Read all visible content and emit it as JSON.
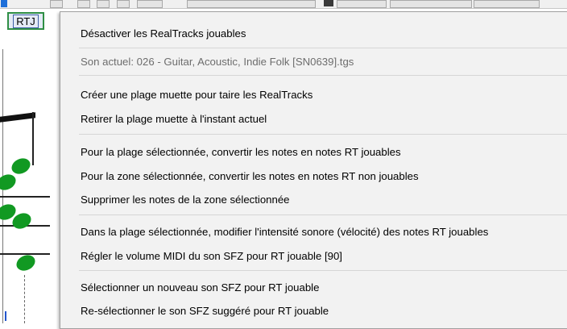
{
  "toolbar": {
    "rtj_label": "RTJ"
  },
  "menu": {
    "deactivate": "Désactiver les RealTracks jouables",
    "current_sound": "Son actuel: 026 - Guitar, Acoustic, Indie Folk [SN0639].tgs",
    "create_mute_range": "Créer une plage muette pour taire les RealTracks",
    "remove_mute_range": "Retirer la plage muette à l'instant actuel",
    "convert_playable": "Pour la plage sélectionnée, convertir les notes en notes RT jouables",
    "convert_non_playable": "Pour la zone sélectionnée, convertir les notes en notes RT non jouables",
    "delete_notes": "Supprimer les notes de la zone sélectionnée",
    "modify_velocity": "Dans la plage sélectionnée, modifier l'intensité sonore (vélocité) des notes RT jouables",
    "set_midi_volume": "Régler le volume MIDI du son SFZ pour RT jouable [90]",
    "select_new_sfz": "Sélectionner un nouveau son SFZ pour RT jouable",
    "reselect_suggested_sfz": "Re-sélectionner le son SFZ suggéré pour RT jouable"
  },
  "colors": {
    "rtj_border": "#2f8f45",
    "note_green": "#119922",
    "menu_bg": "#f2f2f2",
    "disabled_text": "#6d6d6d"
  }
}
